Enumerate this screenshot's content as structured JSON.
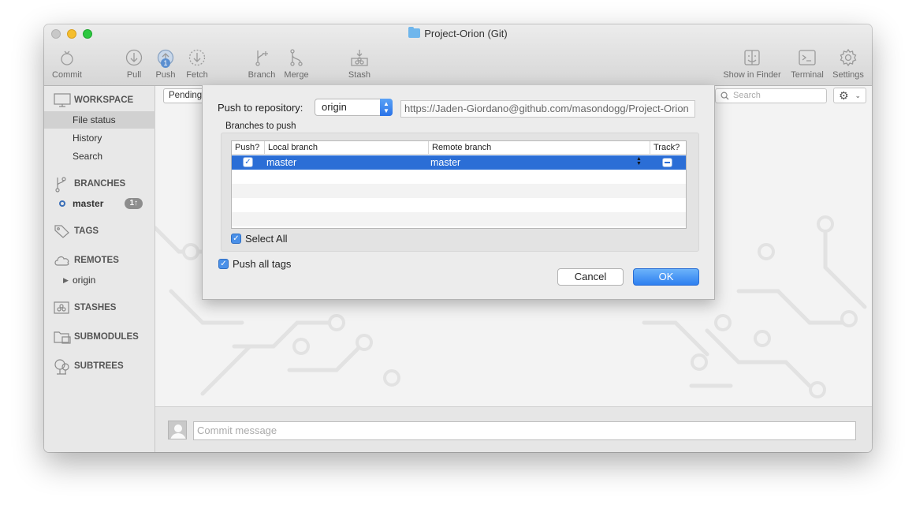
{
  "window": {
    "title": "Project-Orion (Git)"
  },
  "toolbar": {
    "commit": "Commit",
    "pull": "Pull",
    "push": "Push",
    "push_badge": "1",
    "fetch": "Fetch",
    "branch": "Branch",
    "merge": "Merge",
    "stash": "Stash",
    "show_in_finder": "Show in Finder",
    "terminal": "Terminal",
    "settings": "Settings"
  },
  "sidebar": {
    "workspace": "WORKSPACE",
    "workspace_items": [
      "File status",
      "History",
      "Search"
    ],
    "branches": "BRANCHES",
    "branch_name": "master",
    "branch_badge": "1↑",
    "tags": "TAGS",
    "remotes": "REMOTES",
    "remote_name": "origin",
    "stashes": "STASHES",
    "submodules": "SUBMODULES",
    "subtrees": "SUBTREES"
  },
  "main": {
    "pending": "Pending",
    "search_placeholder": "Search",
    "commit_placeholder": "Commit message"
  },
  "dialog": {
    "push_to_label": "Push to repository:",
    "repository": "origin",
    "url": "https://Jaden-Giordano@github.com/masondogg/Project-Orion",
    "branches_label": "Branches to push",
    "columns": [
      "Push?",
      "Local branch",
      "Remote branch",
      "Track?"
    ],
    "rows": [
      {
        "push": true,
        "local": "master",
        "remote": "master",
        "track": true
      }
    ],
    "select_all": "Select All",
    "push_all_tags": "Push all tags",
    "cancel": "Cancel",
    "ok": "OK"
  },
  "colors": {
    "accent": "#2b6ed6",
    "traffic_yellow": "#f5be2d",
    "traffic_green": "#2dc840"
  }
}
